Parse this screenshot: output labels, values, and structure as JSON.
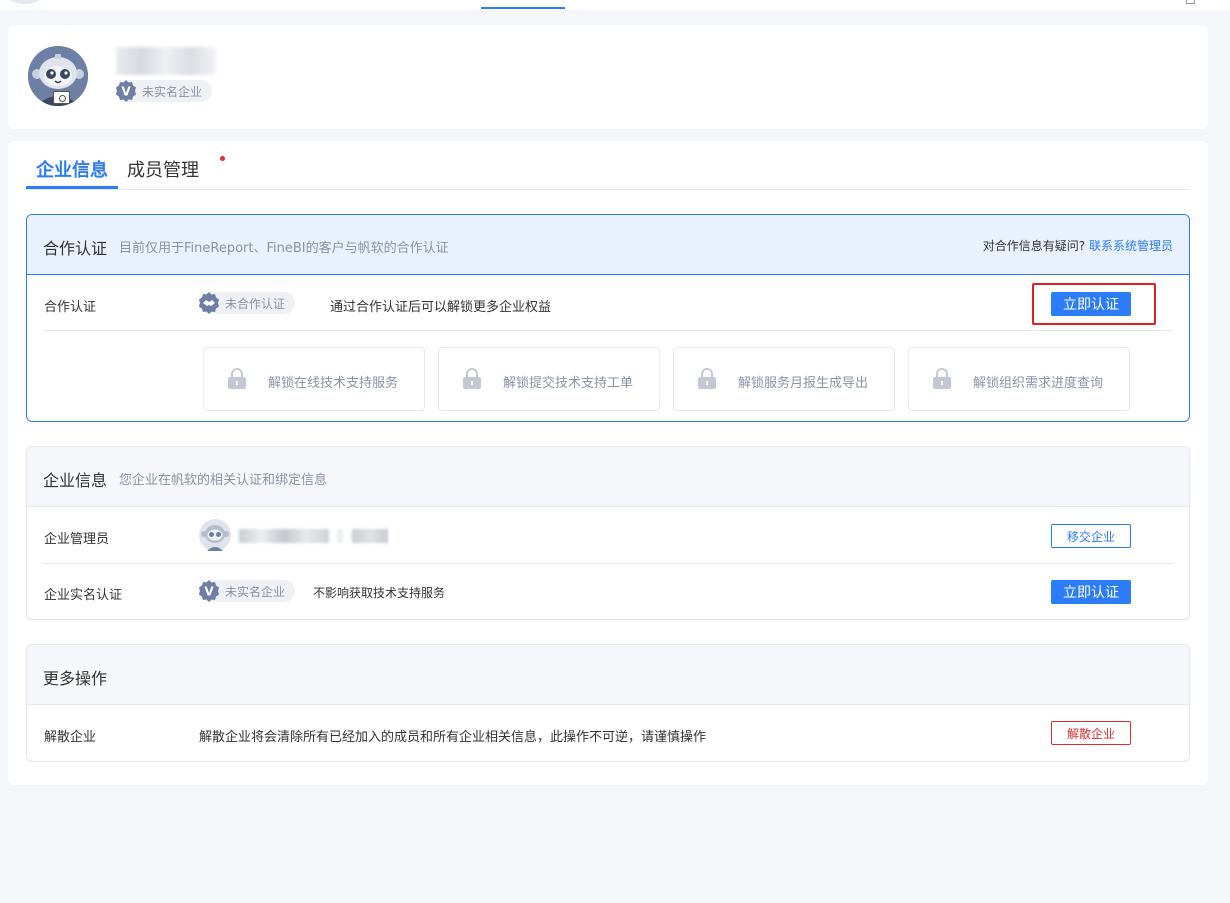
{
  "profile": {
    "status_badge": "未实名企业"
  },
  "tabs": [
    {
      "label": "企业信息"
    },
    {
      "label": "成员管理"
    }
  ],
  "cooperation": {
    "title": "合作认证",
    "subtitle": "目前仅用于FineReport、FineBI的客户与帆软的合作认证",
    "question": "对合作信息有疑问?",
    "contact_link": "联系系统管理员",
    "row_label": "合作认证",
    "status_badge": "未合作认证",
    "description": "通过合作认证后可以解锁更多企业权益",
    "button": "立即认证",
    "features": [
      {
        "label": "解锁在线技术支持服务"
      },
      {
        "label": "解锁提交技术支持工单"
      },
      {
        "label": "解锁服务月报生成导出"
      },
      {
        "label": "解锁组织需求进度查询"
      }
    ]
  },
  "enterprise": {
    "title": "企业信息",
    "subtitle": "您企业在帆软的相关认证和绑定信息",
    "admin_label": "企业管理员",
    "transfer_button": "移交企业",
    "realname_label": "企业实名认证",
    "realname_badge": "未实名企业",
    "realname_note": "不影响获取技术支持服务",
    "realname_button": "立即认证"
  },
  "more": {
    "title": "更多操作",
    "dissolve_label": "解散企业",
    "dissolve_note": "解散企业将会清除所有已经加入的成员和所有企业相关信息，此操作不可逆，请谨慎操作",
    "dissolve_button": "解散企业"
  },
  "colors": {
    "primary": "#2b7cf6",
    "danger": "#e02e2e",
    "highlight": "#e02020"
  }
}
